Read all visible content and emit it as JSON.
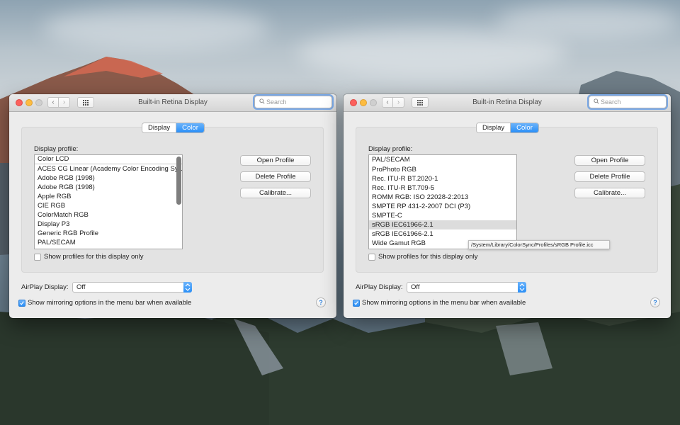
{
  "windows": [
    {
      "title": "Built-in Retina Display",
      "search_placeholder": "Search",
      "tabs": [
        "Display",
        "Color"
      ],
      "active_tab": "Color",
      "profile_label": "Display profile:",
      "profiles": [
        "Color LCD",
        "ACES CG Linear (Academy Color Encoding Sy…",
        "Adobe RGB (1998)",
        "Adobe RGB (1998)",
        "Apple RGB",
        "CIE RGB",
        "ColorMatch RGB",
        "Display P3",
        "Generic RGB Profile",
        "PAL/SECAM"
      ],
      "buttons": {
        "open": "Open Profile",
        "delete": "Delete Profile",
        "calibrate": "Calibrate..."
      },
      "show_only_label": "Show profiles for this display only",
      "airplay_label": "AirPlay Display:",
      "airplay_value": "Off",
      "mirroring_label": "Show mirroring options in the menu bar when available",
      "help": "?"
    },
    {
      "title": "Built-in Retina Display",
      "search_placeholder": "Search",
      "tabs": [
        "Display",
        "Color"
      ],
      "active_tab": "Color",
      "profile_label": "Display profile:",
      "profiles": [
        "PAL/SECAM",
        "ProPhoto RGB",
        "Rec. ITU-R BT.2020-1",
        "Rec. ITU-R BT.709-5",
        "ROMM RGB: ISO 22028-2:2013",
        "SMPTE RP 431-2-2007 DCI (P3)",
        "SMPTE-C",
        "sRGB IEC61966-2.1",
        "sRGB IEC61966-2.1",
        "Wide Gamut RGB"
      ],
      "selected_profile": "sRGB IEC61966-2.1",
      "tooltip": "/System/Library/ColorSync/Profiles/sRGB Profile.icc",
      "buttons": {
        "open": "Open Profile",
        "delete": "Delete Profile",
        "calibrate": "Calibrate..."
      },
      "show_only_label": "Show profiles for this display only",
      "airplay_label": "AirPlay Display:",
      "airplay_value": "Off",
      "mirroring_label": "Show mirroring options in the menu bar when available",
      "help": "?"
    }
  ],
  "icons": {
    "back": "chevron-left-icon",
    "forward": "chevron-right-icon",
    "grid": "grid-icon",
    "search": "search-icon",
    "select": "updown-arrows-icon",
    "check": "checkmark-icon"
  },
  "colors": {
    "accent": "#2a8ff7",
    "close": "#fc605c",
    "minimize": "#fdbc40",
    "zoom": "#cfcfcf"
  }
}
